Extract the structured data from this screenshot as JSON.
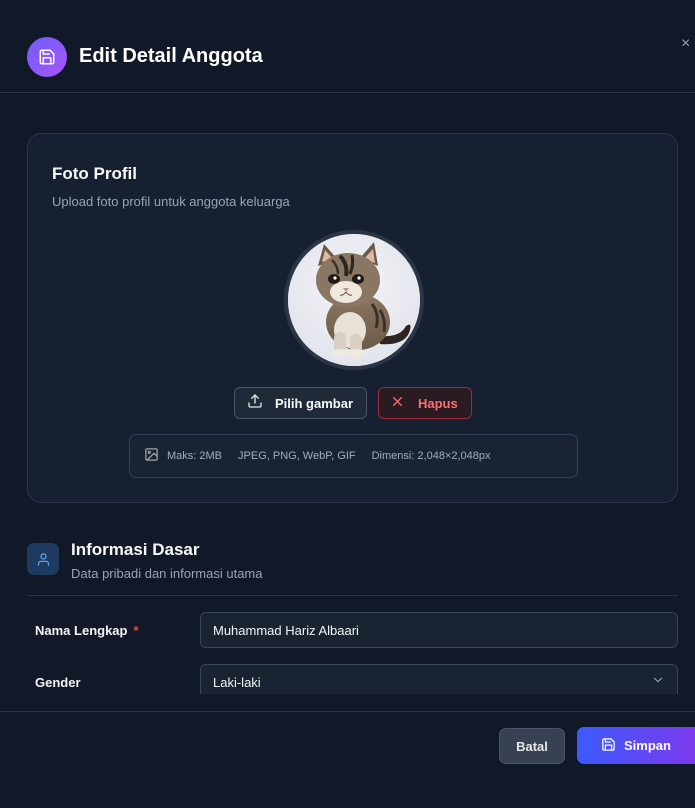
{
  "header": {
    "title": "Edit Detail Anggota",
    "icon": "save-icon",
    "close_symbol": "×",
    "accent": "#8b5cf6"
  },
  "photo": {
    "title": "Foto Profil",
    "subtitle": "Upload foto profil untuk anggota keluarga",
    "avatar": "kitten-photo",
    "choose_label": "Pilih gambar",
    "remove_label": "Hapus",
    "info": {
      "max_size": "Maks: 2MB",
      "formats": "JPEG, PNG, WebP, GIF",
      "dimension": "Dimensi: 2,048×2,048px"
    }
  },
  "basic_info": {
    "title": "Informasi Dasar",
    "subtitle": "Data pribadi dan informasi utama",
    "fields": {
      "full_name": {
        "label": "Nama Lengkap",
        "required_mark": "*",
        "value": "Muhammad Hariz Albaari"
      },
      "gender": {
        "label": "Gender",
        "value": "Laki-laki"
      }
    }
  },
  "footer": {
    "cancel_label": "Batal",
    "save_label": "Simpan"
  },
  "colors": {
    "background": "#111827",
    "danger": "#f87171",
    "primary_gradient_start": "#3b5bfd",
    "primary_gradient_end": "#7c3aed"
  }
}
